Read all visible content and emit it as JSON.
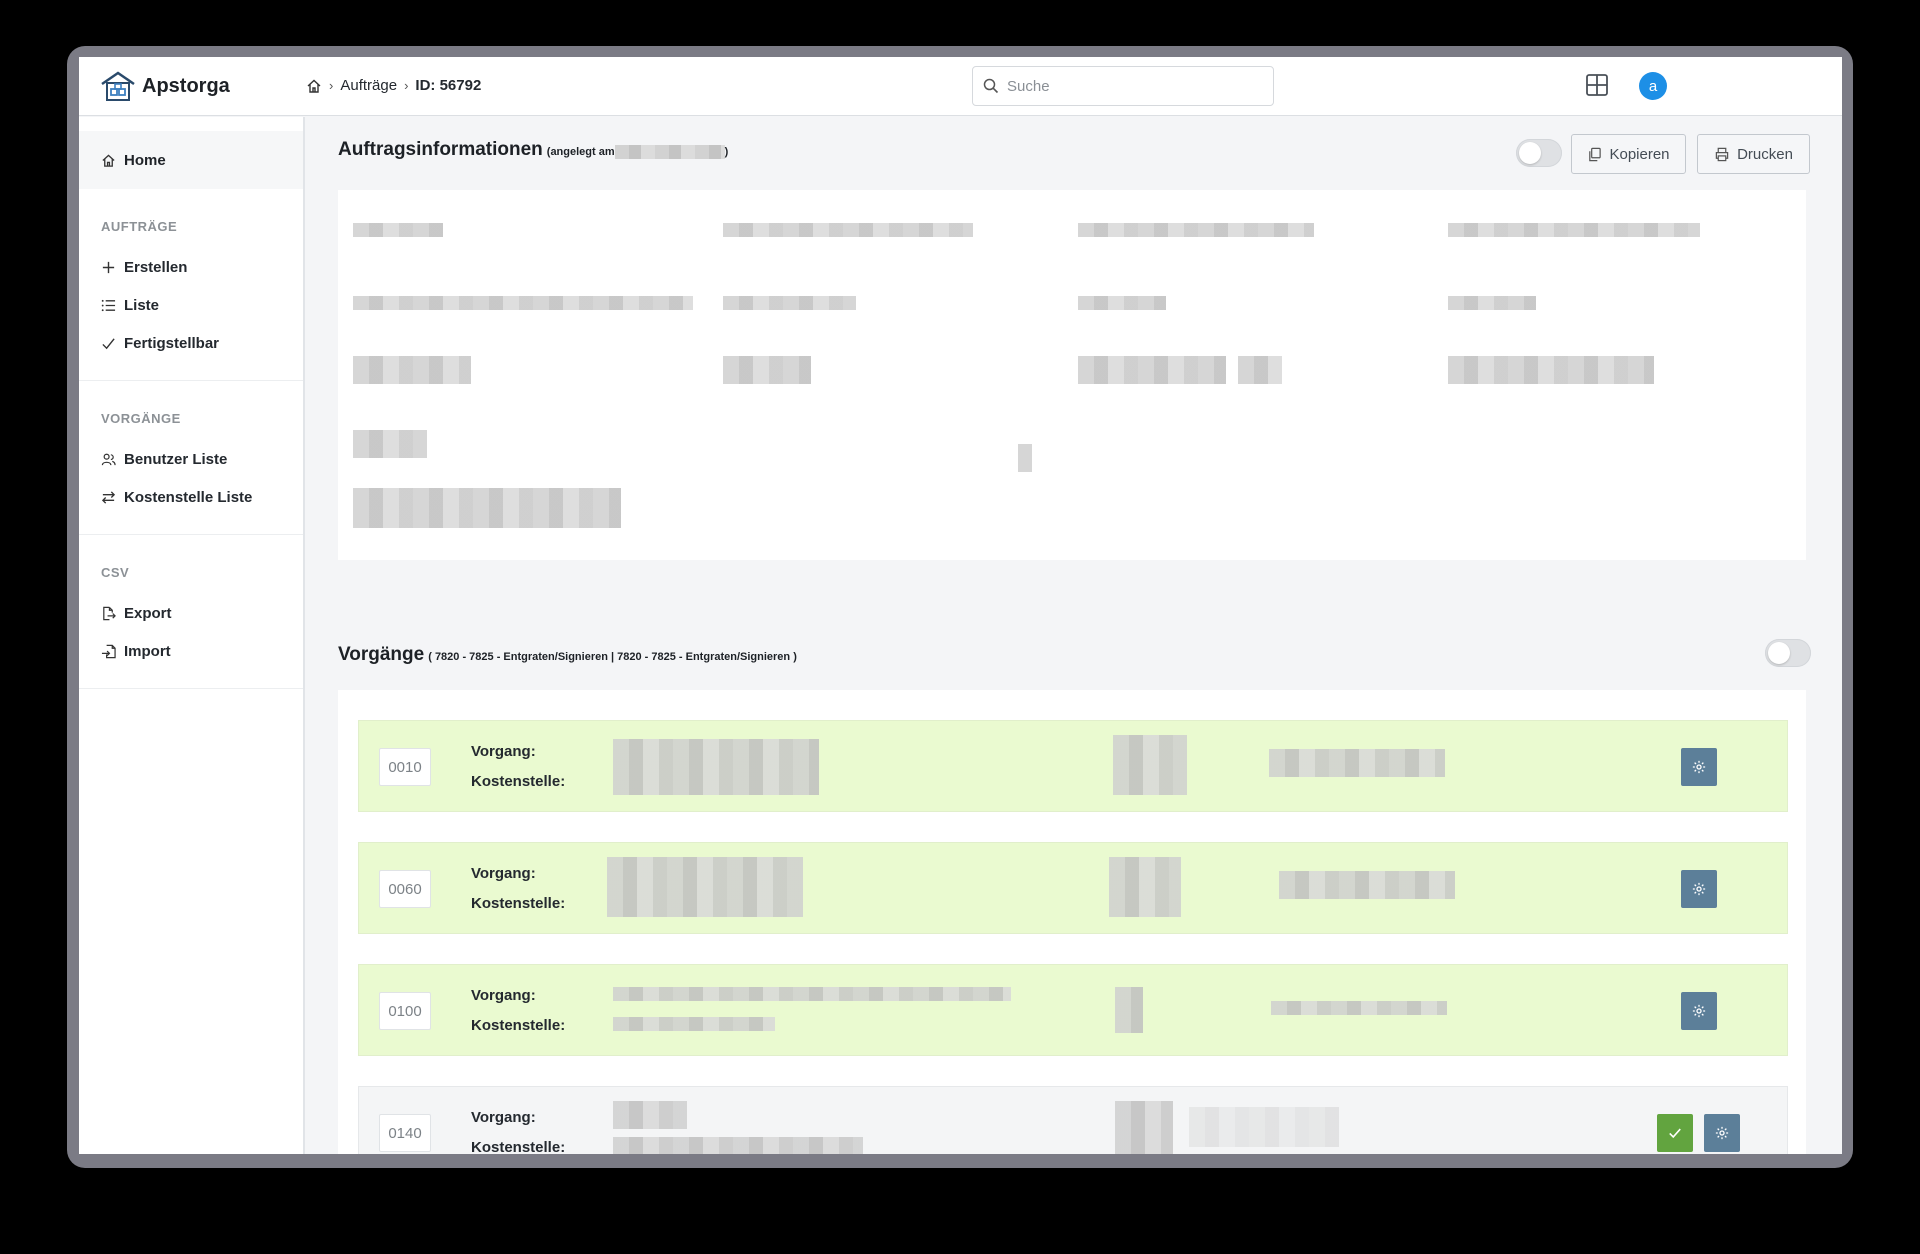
{
  "app": {
    "name": "Apstorga"
  },
  "breadcrumb": {
    "level1": "Aufträge",
    "current": "ID: 56792"
  },
  "search": {
    "placeholder": "Suche"
  },
  "user": {
    "avatar_letter": "a"
  },
  "sidebar": {
    "home": "Home",
    "sections": [
      {
        "title": "AUFTRÄGE",
        "items": [
          "Erstellen",
          "Liste",
          "Fertigstellbar"
        ]
      },
      {
        "title": "VORGÄNGE",
        "items": [
          "Benutzer Liste",
          "Kostenstelle Liste"
        ]
      },
      {
        "title": "CSV",
        "items": [
          "Export",
          "Import"
        ]
      }
    ]
  },
  "auftrag": {
    "title": "Auftragsinformationen",
    "created_prefix": "(angelegt am",
    "created_suffix": ")",
    "copy_label": "Kopieren",
    "print_label": "Drucken"
  },
  "vorgaenge": {
    "title": "Vorgänge",
    "subtitle": "( 7820 - 7825 - Entgraten/Signieren | 7820 - 7825 - Entgraten/Signieren )",
    "label_vorgang": "Vorgang:",
    "label_kostenstelle": "Kostenstelle:",
    "rows": [
      {
        "number": "0010",
        "status": "green"
      },
      {
        "number": "0060",
        "status": "green"
      },
      {
        "number": "0100",
        "status": "green"
      },
      {
        "number": "0140",
        "status": "grey"
      }
    ]
  },
  "colors": {
    "accent": "#1d8fe6",
    "row_green": "#eafad0",
    "gear_button": "#5c7f99",
    "check_button": "#62a43f"
  }
}
